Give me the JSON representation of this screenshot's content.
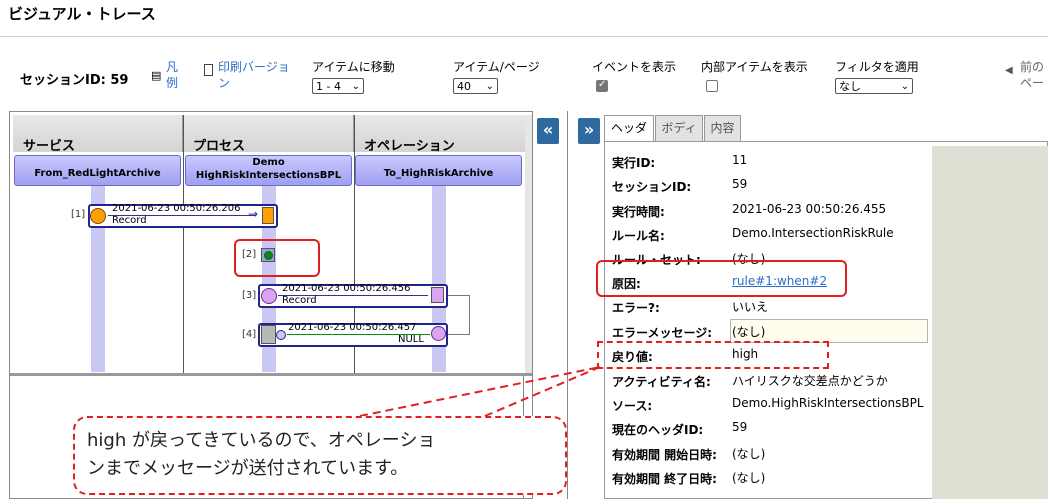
{
  "page": {
    "title": "ビジュアル・トレース"
  },
  "toolbar": {
    "session_label": "セッションID: 59",
    "legend_link": "凡例",
    "print_link": "印刷バージョン",
    "move_label": "アイテムに移動",
    "move_value": "1 - 4",
    "per_page_label": "アイテム/ページ",
    "per_page_value": "40",
    "show_events_label": "イベントを表示",
    "show_internal_label": "内部アイテムを表示",
    "filter_label": "フィルタを適用",
    "filter_value": "なし",
    "prev_page": "前のページ"
  },
  "diagram": {
    "columns": [
      {
        "header": "サービス",
        "component": "From_RedLightArchive"
      },
      {
        "header": "プロセス",
        "component_line1": "Demo",
        "component_line2": "HighRiskIntersectionsBPL"
      },
      {
        "header": "オペレーション",
        "component": "To_HighRiskArchive"
      }
    ],
    "calls": [
      {
        "index": "[1]",
        "time": "2021-06-23 00:50:26.206",
        "label": "Record"
      },
      {
        "index": "[2]"
      },
      {
        "index": "[3]",
        "time": "2021-06-23 00:50:26.456",
        "label": "Record"
      },
      {
        "index": "[4]",
        "time": "2021-06-23 00:50:26.457",
        "label": "NULL"
      }
    ],
    "collapse_glyph": "«"
  },
  "details": {
    "expand_glyph": "»",
    "tabs": [
      "ヘッダ",
      "ボディ",
      "内容"
    ],
    "rows": [
      {
        "label": "実行ID:",
        "value": "11"
      },
      {
        "label": "セッションID:",
        "value": "59"
      },
      {
        "label": "実行時間:",
        "value": "2021-06-23 00:50:26.455"
      },
      {
        "label": "ルール名:",
        "value": "Demo.IntersectionRiskRule"
      },
      {
        "label": "ルール・セット:",
        "value": "(なし)"
      },
      {
        "label": "原因:",
        "value": "rule#1:when#2"
      },
      {
        "label": "エラー?:",
        "value": "いいえ"
      },
      {
        "label": "エラーメッセージ:",
        "value": "(なし)"
      },
      {
        "label": "戻り値:",
        "value": "high"
      },
      {
        "label": "アクティビティ名:",
        "value": "ハイリスクな交差点かどうか"
      },
      {
        "label": "ソース:",
        "value": "Demo.HighRiskIntersectionsBPL"
      },
      {
        "label": "現在のヘッダID:",
        "value": "59"
      },
      {
        "label": "有効期間 開始日時:",
        "value": "(なし)"
      },
      {
        "label": "有効期間 終了日時:",
        "value": "(なし)"
      }
    ]
  },
  "callout": {
    "line1": "high が戻ってきているので、オペレーショ",
    "line2": "ンまでメッセージが送付されています。"
  },
  "colors": {
    "annotation_red": "#e02020",
    "accent_blue": "#2e6a9e",
    "call_border": "#23238c"
  }
}
